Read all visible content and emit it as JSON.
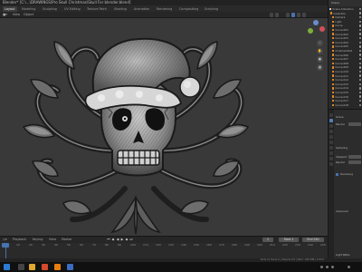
{
  "window": {
    "title": "Blender* [C:\\...\\DRAWINGS\\Pro Skull Christmas\\Skull For blender.blend]"
  },
  "workspace_tabs": [
    {
      "label": "Layout",
      "active": true
    },
    {
      "label": "Modeling",
      "active": false
    },
    {
      "label": "Sculpting",
      "active": false
    },
    {
      "label": "UV Editing",
      "active": false
    },
    {
      "label": "Texture Paint",
      "active": false
    },
    {
      "label": "Shading",
      "active": false
    },
    {
      "label": "Animation",
      "active": false
    },
    {
      "label": "Rendering",
      "active": false
    },
    {
      "label": "Compositing",
      "active": false
    },
    {
      "label": "Scripting",
      "active": false
    }
  ],
  "viewport": {
    "menus": [
      "View",
      "Object"
    ],
    "info_text": ""
  },
  "outliner": {
    "header": "Scene",
    "rows": [
      "Scene Collection",
      "Collection",
      "Camera",
      "Light",
      "Curve",
      "Curve.001",
      "Curve.002",
      "Curve.003",
      "Curve.004",
      "Curve.005",
      "OrnamentSet",
      "Curve.006",
      "Curve.007",
      "Curve.008",
      "Curve.009",
      "Curve.010",
      "Curve.011",
      "Curve.012",
      "Curve.013",
      "Curve.014",
      "Curve.015",
      "Curve.016",
      "Curve.017",
      "Curve.018"
    ]
  },
  "properties": {
    "rows": [
      "Scene",
      "Render",
      "Sampling",
      "Viewport",
      "Render",
      "Denoising",
      "Advanced",
      "Light Paths"
    ]
  },
  "timeline": {
    "menus": [
      "Playback",
      "Keying",
      "View",
      "Marker"
    ],
    "current_frame": "1",
    "start": "Start 1",
    "end": "End 250",
    "ticks": [
      "0",
      "10",
      "20",
      "30",
      "40",
      "50",
      "60",
      "70",
      "80",
      "90",
      "100",
      "110",
      "120",
      "130",
      "140",
      "150",
      "160",
      "170",
      "180",
      "190",
      "200",
      "210",
      "220",
      "230",
      "240",
      "250"
    ]
  },
  "statusbar": {
    "text": "Verts 0 | Faces 0 | Objects 0/1 | Mem: 180 MiB | 2.83.0"
  },
  "colors": {
    "accent": "#4772b3",
    "viewport_bg": "#393939",
    "outliner_icon": "#e08a2c"
  }
}
